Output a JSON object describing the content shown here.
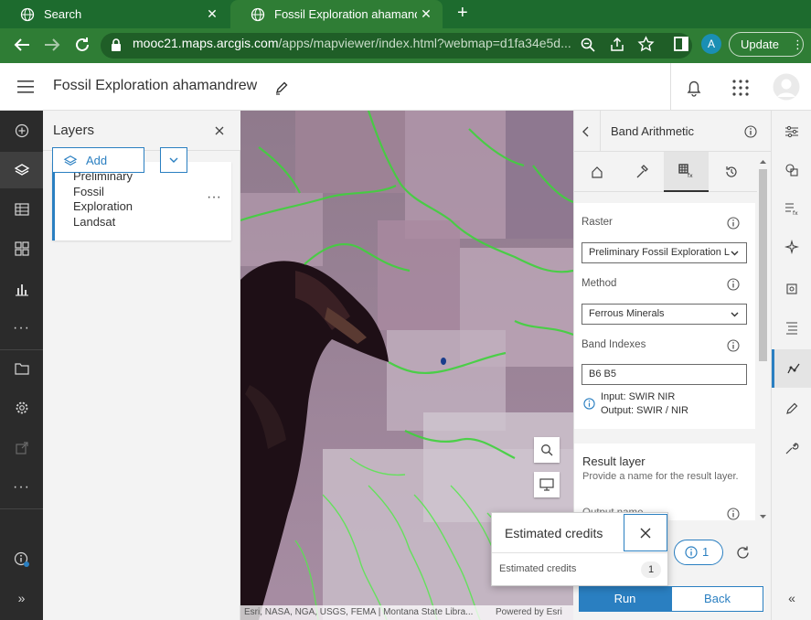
{
  "browser": {
    "tabs": [
      {
        "title": "Search",
        "active": false
      },
      {
        "title": "Fossil Exploration ahamandrew",
        "active": true
      }
    ],
    "url_host": "mooc21.maps.arcgis.com",
    "url_path": "/apps/mapviewer/index.html?webmap=d1fa34e5d...",
    "profile_initial": "A",
    "update_label": "Update"
  },
  "app": {
    "title": "Fossil Exploration ahamandrew"
  },
  "layers_panel": {
    "heading": "Layers",
    "layer_name": "Preliminary Fossil Exploration Landsat",
    "add_label": "Add"
  },
  "map": {
    "attribution": "Esri, NASA, NGA, USGS, FEMA | Montana State Libra...",
    "powered_by": "Powered by Esri"
  },
  "band_panel": {
    "heading": "Band Arithmetic",
    "raster_label": "Raster",
    "raster_value": "Preliminary Fossil Exploration L",
    "method_label": "Method",
    "method_value": "Ferrous Minerals",
    "band_indexes_label": "Band Indexes",
    "band_indexes_value": "B6 B5",
    "input_note": "Input: SWIR NIR",
    "output_note": "Output: SWIR / NIR",
    "result_heading": "Result layer",
    "result_desc": "Provide a name for the result layer.",
    "output_name_label": "Output name",
    "credits_count": "1",
    "run_label": "Run",
    "back_label": "Back"
  },
  "credits_popover": {
    "title": "Estimated credits",
    "label": "Estimated credits",
    "count": "1"
  },
  "colors": {
    "browser_green": "#2f7d35",
    "accent_blue": "#2a7fc1",
    "sidebar_dark": "#2b2b2b"
  }
}
